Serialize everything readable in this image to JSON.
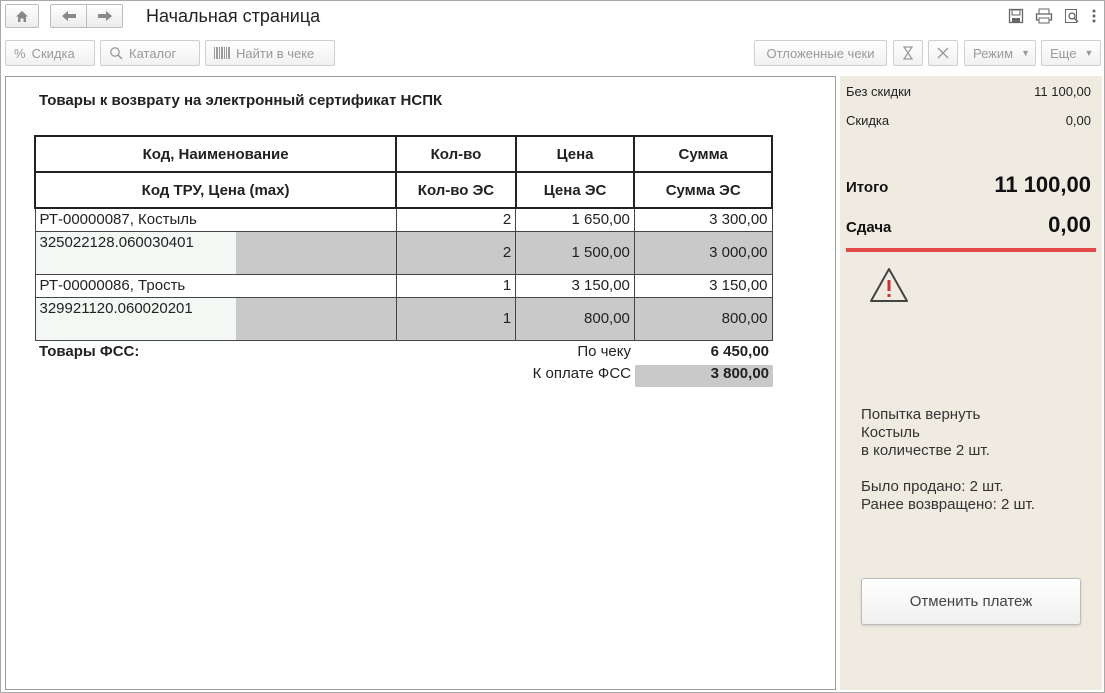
{
  "window": {
    "title": "Начальная страница"
  },
  "toolbar": {
    "discount": "Скидка",
    "catalog": "Каталог",
    "find_in_receipt": "Найти в чеке",
    "deferred_receipts": "Отложенные чеки",
    "mode": "Режим",
    "more": "Еще"
  },
  "main": {
    "heading": "Товары к возврату на электронный сертификат НСПК",
    "columns": {
      "code_name": "Код, Наименование",
      "qty": "Кол-во",
      "price": "Цена",
      "sum": "Сумма",
      "tru_code": "Код ТРУ, Цена (max)",
      "qty_es": "Кол-во ЭС",
      "price_es": "Цена ЭС",
      "sum_es": "Сумма ЭС"
    },
    "items": [
      {
        "name": "РТ-00000087, Костыль",
        "qty": "2",
        "price": "1 650,00",
        "sum": "3 300,00",
        "tru_code": "325022128.060030401",
        "qty_es": "2",
        "price_es": "1 500,00",
        "sum_es": "3 000,00"
      },
      {
        "name": "РТ-00000086, Трость",
        "qty": "1",
        "price": "3 150,00",
        "sum": "3 150,00",
        "tru_code": "329921120.060020201",
        "qty_es": "1",
        "price_es": "800,00",
        "sum_es": "800,00"
      }
    ],
    "totals": {
      "fss_label": "Товары ФСС:",
      "by_receipt_label": "По чеку",
      "by_receipt_value": "6 450,00",
      "to_pay_label": "К оплате ФСС",
      "to_pay_value": "3 800,00"
    }
  },
  "summary": {
    "no_discount_label": "Без скидки",
    "no_discount_value": "11 100,00",
    "discount_label": "Скидка",
    "discount_value": "0,00",
    "total_label": "Итого",
    "total_value": "11 100,00",
    "change_label": "Сдача",
    "change_value": "0,00",
    "accent_color": "#e24a4a",
    "warning_icon": "warning-triangle-icon",
    "message_lines": [
      "Попытка вернуть",
      "Костыль",
      "в количестве 2 шт.",
      "",
      "Было продано: 2 шт.",
      "Ранее возвращено: 2 шт."
    ],
    "cancel_payment": "Отменить платеж"
  }
}
